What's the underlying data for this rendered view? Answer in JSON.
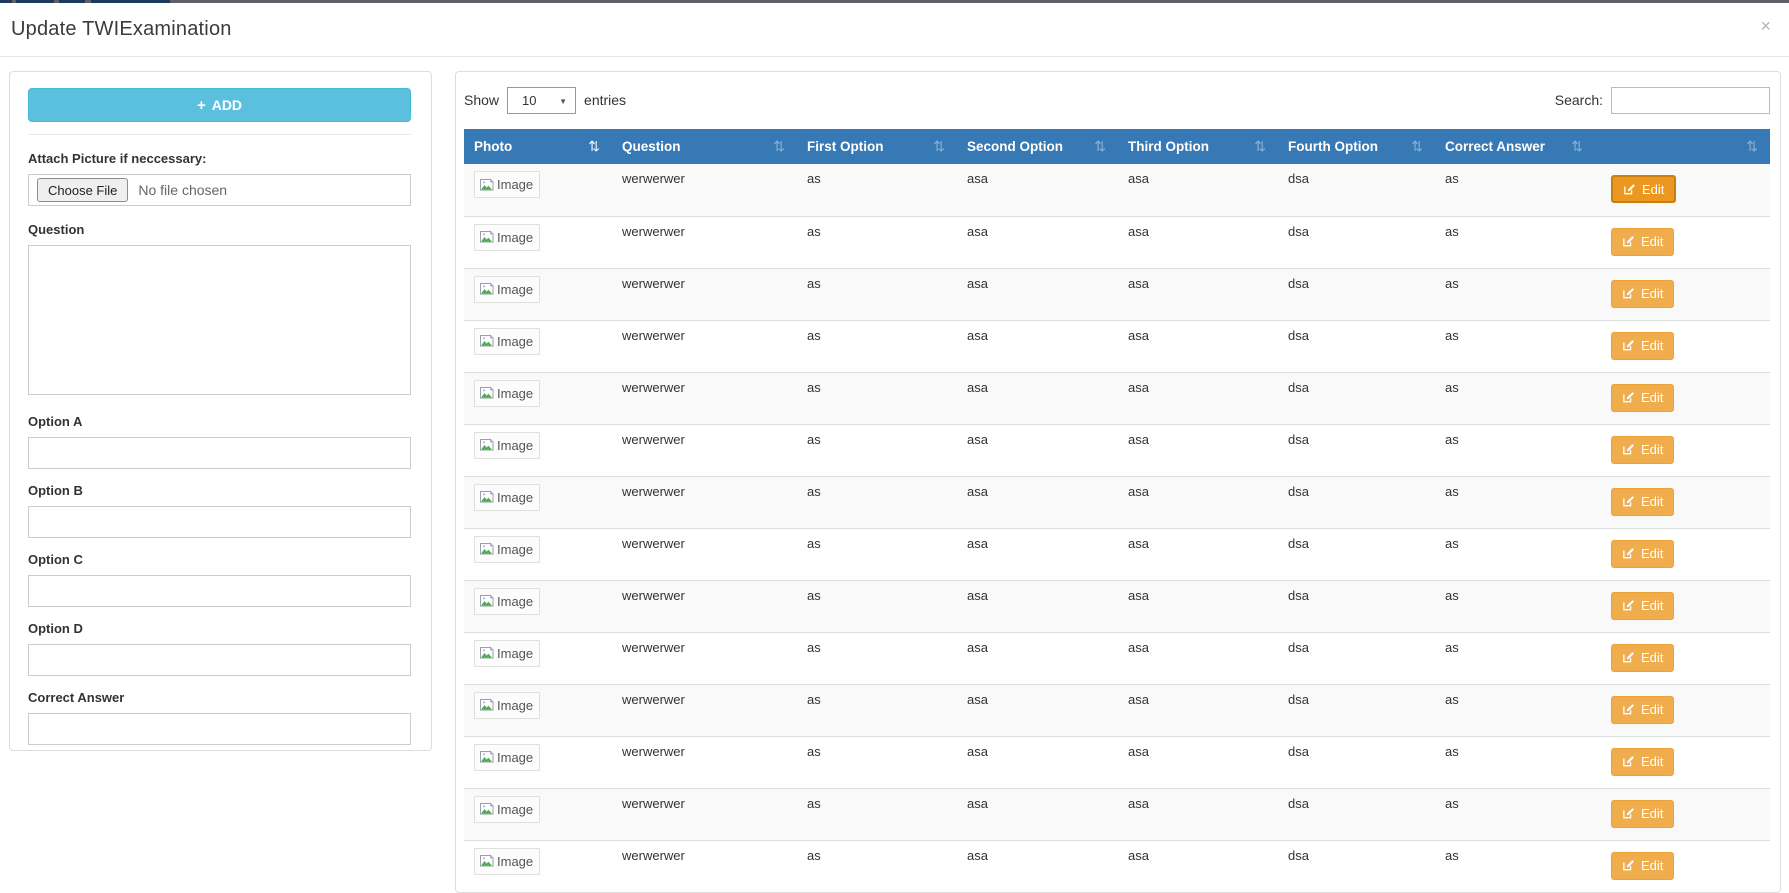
{
  "window": {
    "title": "Update TWIExamination"
  },
  "icons": {
    "close": "×",
    "plus": "+",
    "sort": "⇅",
    "caret": "▼"
  },
  "colors": {
    "header_blue": "#3779b5",
    "add_button": "#5bc0de",
    "edit_button": "#f0ad4e",
    "edit_button_active": "#ec971f"
  },
  "form": {
    "add_label": "ADD",
    "attach_label": "Attach Picture if neccessary:",
    "file_input": {
      "button_label": "Choose File",
      "status": "No file chosen"
    },
    "question_label": "Question",
    "option_labels": [
      "Option A",
      "Option B",
      "Option C",
      "Option D"
    ],
    "correct_label": "Correct Answer"
  },
  "table": {
    "length_before": "Show",
    "length_value": "10",
    "length_after": "entries",
    "search_label": "Search:",
    "search_value": "",
    "columns": [
      "Photo",
      "Question",
      "First Option",
      "Second Option",
      "Third Option",
      "Fourth Option",
      "Correct Answer",
      ""
    ],
    "edit_label": "Edit",
    "photo_alt": "Image",
    "rows": [
      {
        "question": "werwerwer",
        "first": "as",
        "second": "asa",
        "third": "asa",
        "fourth": "dsa",
        "correct": "as"
      },
      {
        "question": "werwerwer",
        "first": "as",
        "second": "asa",
        "third": "asa",
        "fourth": "dsa",
        "correct": "as"
      },
      {
        "question": "werwerwer",
        "first": "as",
        "second": "asa",
        "third": "asa",
        "fourth": "dsa",
        "correct": "as"
      },
      {
        "question": "werwerwer",
        "first": "as",
        "second": "asa",
        "third": "asa",
        "fourth": "dsa",
        "correct": "as"
      },
      {
        "question": "werwerwer",
        "first": "as",
        "second": "asa",
        "third": "asa",
        "fourth": "dsa",
        "correct": "as"
      },
      {
        "question": "werwerwer",
        "first": "as",
        "second": "asa",
        "third": "asa",
        "fourth": "dsa",
        "correct": "as"
      },
      {
        "question": "werwerwer",
        "first": "as",
        "second": "asa",
        "third": "asa",
        "fourth": "dsa",
        "correct": "as"
      },
      {
        "question": "werwerwer",
        "first": "as",
        "second": "asa",
        "third": "asa",
        "fourth": "dsa",
        "correct": "as"
      },
      {
        "question": "werwerwer",
        "first": "as",
        "second": "asa",
        "third": "asa",
        "fourth": "dsa",
        "correct": "as"
      },
      {
        "question": "werwerwer",
        "first": "as",
        "second": "asa",
        "third": "asa",
        "fourth": "dsa",
        "correct": "as"
      },
      {
        "question": "werwerwer",
        "first": "as",
        "second": "asa",
        "third": "asa",
        "fourth": "dsa",
        "correct": "as"
      },
      {
        "question": "werwerwer",
        "first": "as",
        "second": "asa",
        "third": "asa",
        "fourth": "dsa",
        "correct": "as"
      },
      {
        "question": "werwerwer",
        "first": "as",
        "second": "asa",
        "third": "asa",
        "fourth": "dsa",
        "correct": "as"
      },
      {
        "question": "werwerwer",
        "first": "as",
        "second": "asa",
        "third": "asa",
        "fourth": "dsa",
        "correct": "as"
      }
    ]
  }
}
